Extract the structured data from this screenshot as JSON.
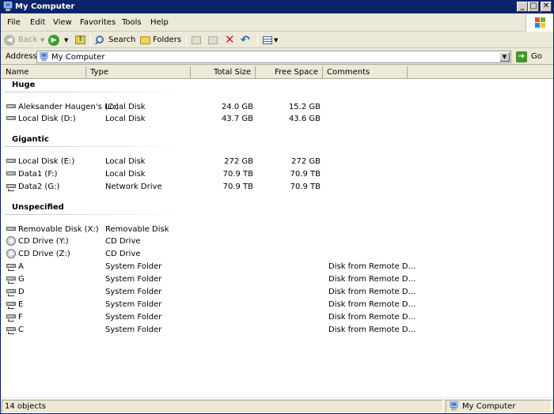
{
  "window": {
    "title": "My Computer"
  },
  "menu": [
    "File",
    "Edit",
    "View",
    "Favorites",
    "Tools",
    "Help"
  ],
  "toolbar": {
    "back": "Back",
    "search": "Search",
    "folders": "Folders"
  },
  "address": {
    "label": "Address",
    "value": "My Computer",
    "go": "Go"
  },
  "columns": {
    "name": "Name",
    "type": "Type",
    "total": "Total Size",
    "free": "Free Space",
    "comments": "Comments"
  },
  "groups": [
    {
      "title": "Huge",
      "items": [
        {
          "name": "Aleksander Haugen's (C:)",
          "type": "Local Disk",
          "total": "24.0 GB",
          "free": "15.2 GB",
          "comment": "",
          "icon": "local-disk-icon"
        },
        {
          "name": "Local Disk (D:)",
          "type": "Local Disk",
          "total": "43.7 GB",
          "free": "43.6 GB",
          "comment": "",
          "icon": "local-disk-icon"
        }
      ]
    },
    {
      "title": "Gigantic",
      "items": [
        {
          "name": "Local Disk (E:)",
          "type": "Local Disk",
          "total": "272 GB",
          "free": "272 GB",
          "comment": "",
          "icon": "local-disk-icon"
        },
        {
          "name": "Data1 (F:)",
          "type": "Local Disk",
          "total": "70.9 TB",
          "free": "70.9 TB",
          "comment": "",
          "icon": "local-disk-icon"
        },
        {
          "name": "Data2 (G:)",
          "type": "Network Drive",
          "total": "70.9 TB",
          "free": "70.9 TB",
          "comment": "",
          "icon": "network-drive-icon"
        }
      ]
    },
    {
      "title": "Unspecified",
      "items": [
        {
          "name": "Removable Disk (X:)",
          "type": "Removable Disk",
          "total": "",
          "free": "",
          "comment": "",
          "icon": "removable-disk-icon"
        },
        {
          "name": "CD Drive (Y:)",
          "type": "CD Drive",
          "total": "",
          "free": "",
          "comment": "",
          "icon": "cd-drive-icon"
        },
        {
          "name": "CD Drive (Z:)",
          "type": "CD Drive",
          "total": "",
          "free": "",
          "comment": "",
          "icon": "cd-drive-icon"
        },
        {
          "name": "A",
          "type": "System Folder",
          "total": "",
          "free": "",
          "comment": "Disk from Remote D...",
          "icon": "network-drive-icon"
        },
        {
          "name": "G",
          "type": "System Folder",
          "total": "",
          "free": "",
          "comment": "Disk from Remote D...",
          "icon": "network-drive-icon"
        },
        {
          "name": "D",
          "type": "System Folder",
          "total": "",
          "free": "",
          "comment": "Disk from Remote D...",
          "icon": "network-drive-icon"
        },
        {
          "name": "E",
          "type": "System Folder",
          "total": "",
          "free": "",
          "comment": "Disk from Remote D...",
          "icon": "network-drive-icon"
        },
        {
          "name": "F",
          "type": "System Folder",
          "total": "",
          "free": "",
          "comment": "Disk from Remote D...",
          "icon": "network-drive-icon"
        },
        {
          "name": "C",
          "type": "System Folder",
          "total": "",
          "free": "",
          "comment": "Disk from Remote D...",
          "icon": "network-drive-icon"
        }
      ]
    }
  ],
  "status": {
    "count": "14 objects",
    "location": "My Computer"
  }
}
